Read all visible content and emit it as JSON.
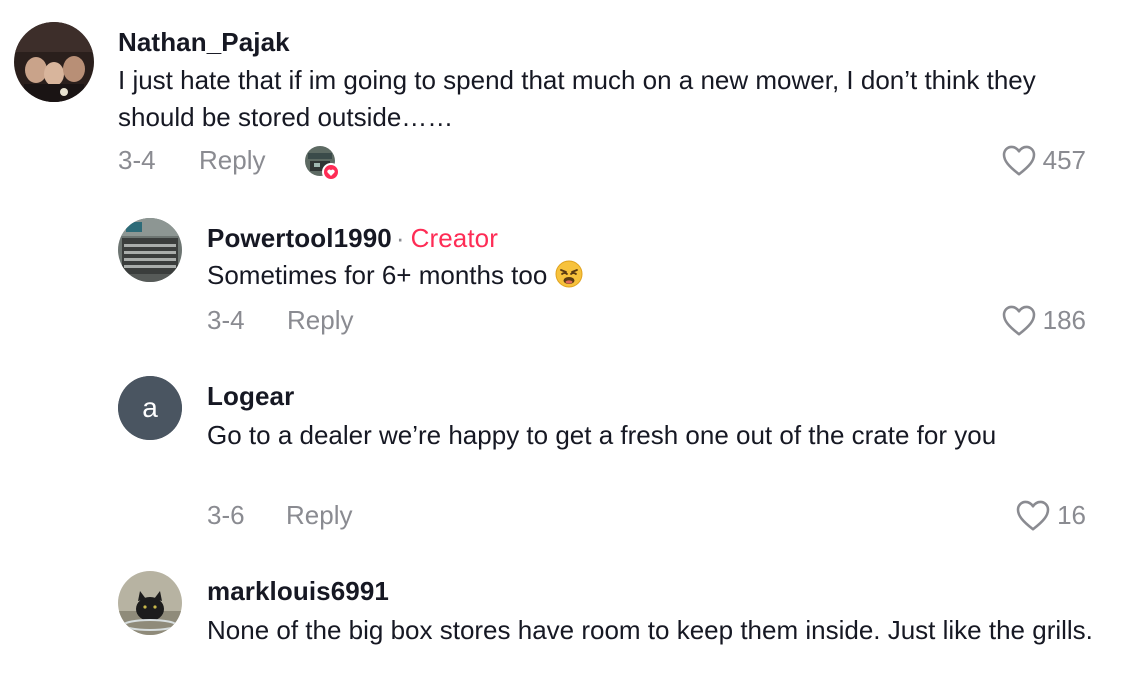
{
  "comments": [
    {
      "username": "Nathan_Pajak",
      "text": "I just hate that if im going to spend that much on a new mower, I don’t think they should be stored outside……",
      "date": "3-4",
      "reply_label": "Reply",
      "likes": "457"
    },
    {
      "username": "Powertool1990",
      "separator": "·",
      "badge": "Creator",
      "text": "Sometimes for 6+ months too",
      "date": "3-4",
      "reply_label": "Reply",
      "likes": "186"
    },
    {
      "username": "Logear",
      "avatar_letter": "a",
      "text": "Go to a dealer we’re happy to get a fresh one out of the crate for you",
      "date": "3-6",
      "reply_label": "Reply",
      "likes": "16"
    },
    {
      "username": "marklouis6991",
      "text": "None of the big box stores have room to keep them inside. Just like the grills."
    }
  ],
  "colors": {
    "text": "#161823",
    "secondary": "#8a8b91",
    "creator": "#fe2c55",
    "letter_avatar_bg": "#4a5561"
  }
}
